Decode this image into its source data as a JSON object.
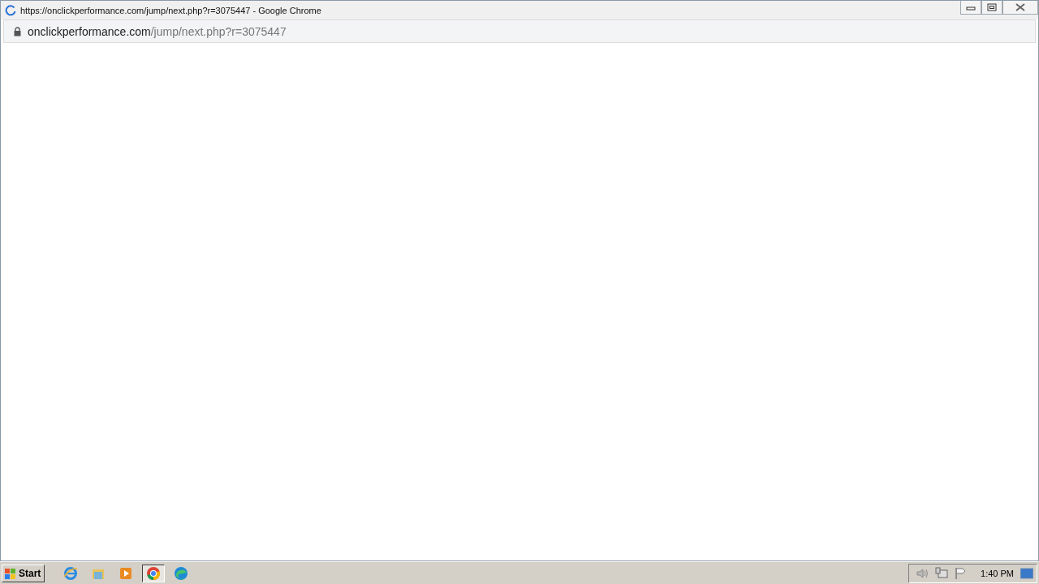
{
  "window": {
    "title": "https://onclickperformance.com/jump/next.php?r=3075447 - Google Chrome"
  },
  "address_bar": {
    "host": "onclickperformance.com",
    "path": "/jump/next.php?r=3075447"
  },
  "taskbar": {
    "start": "Start",
    "apps": [
      {
        "kind": "ie",
        "selected": false
      },
      {
        "kind": "folder",
        "selected": false
      },
      {
        "kind": "media",
        "selected": false
      },
      {
        "kind": "chrome",
        "selected": true
      },
      {
        "kind": "edge",
        "selected": false
      }
    ],
    "clock": "1:40 PM"
  }
}
